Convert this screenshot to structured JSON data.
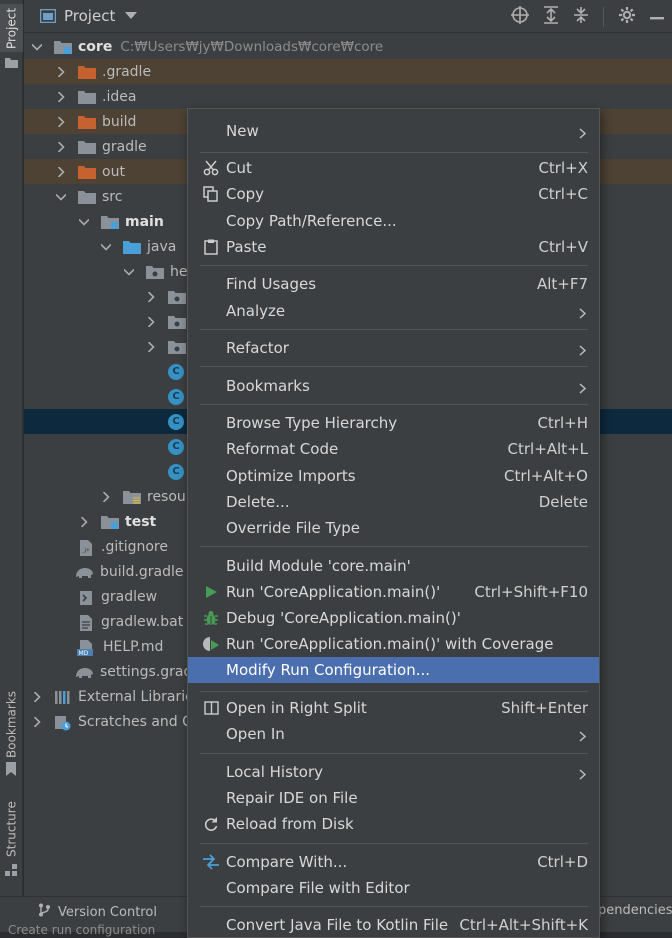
{
  "stripe": {
    "project": "Project",
    "bookmarks": "Bookmarks",
    "structure": "Structure"
  },
  "header": {
    "title": "Project"
  },
  "tree": {
    "root_name": "core",
    "root_path": "C:₩Users₩jy₩Downloads₩core₩core",
    "gradle_dir": ".gradle",
    "idea_dir": ".idea",
    "build_dir": "build",
    "gradle_dir2": "gradle",
    "out_dir": "out",
    "src_dir": "src",
    "main_dir": "main",
    "java_dir": "java",
    "pkg_dir": "he",
    "resources_dir": "resour",
    "test_dir": "test",
    "gitignore": ".gitignore",
    "build_gradle": "build.gradle",
    "gradlew": "gradlew",
    "gradlew_bat": "gradlew.bat",
    "help_md": "HELP.md",
    "settings_gradle": "settings.grad",
    "external_libs": "External Librarie",
    "scratches": "Scratches and C"
  },
  "menu": {
    "new": "New",
    "cut": "Cut",
    "cut_sc": "Ctrl+X",
    "copy": "Copy",
    "copy_sc": "Ctrl+C",
    "copy_path": "Copy Path/Reference...",
    "paste": "Paste",
    "paste_sc": "Ctrl+V",
    "find_usages": "Find Usages",
    "find_usages_sc": "Alt+F7",
    "analyze": "Analyze",
    "refactor": "Refactor",
    "bookmarks": "Bookmarks",
    "browse_type_hierarchy": "Browse Type Hierarchy",
    "browse_type_hierarchy_sc": "Ctrl+H",
    "reformat_code": "Reformat Code",
    "reformat_code_sc": "Ctrl+Alt+L",
    "optimize_imports": "Optimize Imports",
    "optimize_imports_sc": "Ctrl+Alt+O",
    "delete": "Delete...",
    "delete_sc": "Delete",
    "override_file_type": "Override File Type",
    "build_module": "Build Module 'core.main'",
    "run": "Run 'CoreApplication.main()'",
    "run_sc": "Ctrl+Shift+F10",
    "debug": "Debug 'CoreApplication.main()'",
    "run_coverage": "Run 'CoreApplication.main()' with Coverage",
    "modify_run_config": "Modify Run Configuration...",
    "open_right_split": "Open in Right Split",
    "open_right_split_sc": "Shift+Enter",
    "open_in": "Open In",
    "local_history": "Local History",
    "repair_ide": "Repair IDE on File",
    "reload_disk": "Reload from Disk",
    "compare_with": "Compare With...",
    "compare_with_sc": "Ctrl+D",
    "compare_editor": "Compare File with Editor",
    "convert_kotlin": "Convert Java File to Kotlin File",
    "convert_kotlin_sc": "Ctrl+Alt+Shift+K"
  },
  "bottom": {
    "version_control": "Version Control",
    "dependencies": "pendencies",
    "status": "Create run configuration"
  },
  "colors": {
    "excluded_folder": "#c5622f",
    "source_folder": "#4a9fd8",
    "highlight": "#4b6eaf",
    "selection": "#0d293e"
  }
}
